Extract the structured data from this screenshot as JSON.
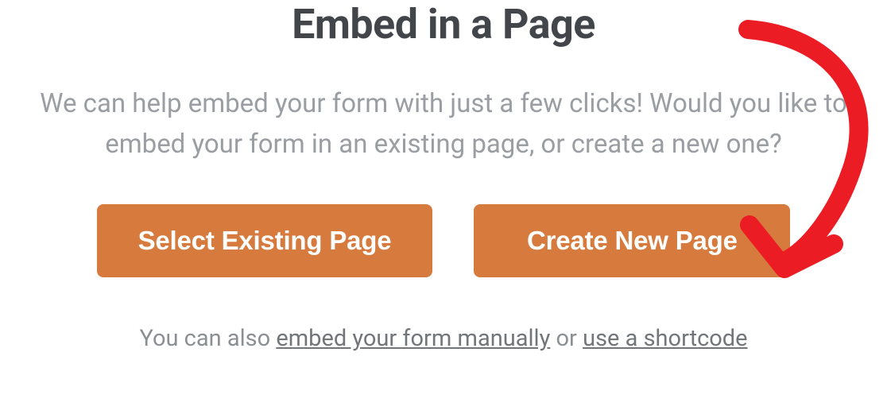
{
  "modal": {
    "title": "Embed in a Page",
    "subtitle": "We can help embed your form with just a few clicks! Would you like to embed your form in an existing page, or create a new one?",
    "buttons": {
      "existing": "Select Existing Page",
      "new": "Create New Page"
    },
    "footer": {
      "prefix": "You can also ",
      "manual_link": "embed your form manually",
      "middle": " or ",
      "shortcode_link": "use a shortcode"
    }
  },
  "annotation": {
    "arrow_target": "create-new-page-button",
    "stroke": "#EC1C24"
  }
}
